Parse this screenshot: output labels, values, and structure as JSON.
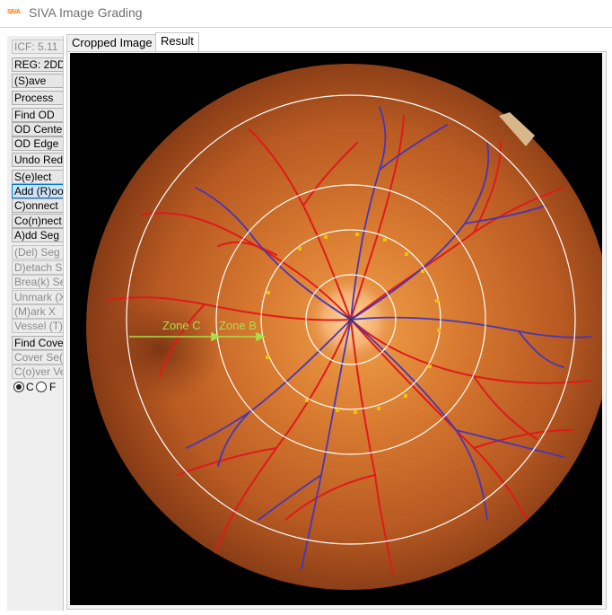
{
  "app": {
    "logo_text": "SIVA",
    "title": "SIVA Image Grading"
  },
  "sidebar": {
    "icf_label": "ICF: 5.11",
    "reg_label": "REG: 2DD",
    "save": "(S)ave",
    "process": "Process",
    "find_od": "Find OD",
    "od_center": "OD Center",
    "od_edge": "OD Edge",
    "undo_redo": "Undo Redo",
    "select": "S(e)lect",
    "add_root": "Add (R)oot",
    "connect": "C)onnect",
    "connect2": "Co(n)nect",
    "add_seg": "A)dd Seg",
    "del_seg": "(Del) Seg",
    "detach_s": "D)etach S",
    "break_seg": "Brea(k) Seg",
    "unmark": "Unmark (X)",
    "mark_x": "(M)ark X",
    "vessel_type": "Vessel (T)ype",
    "find_cover": "Find Cover",
    "cover_se": "Cover Se(q)",
    "cover_ve": "C(o)ver Ve",
    "radio_c": "C",
    "radio_f": "F"
  },
  "tabs": {
    "cropped_image": "Cropped Image",
    "result": "Result"
  },
  "overlay": {
    "zone_c": "Zone C",
    "zone_b": "Zone B"
  },
  "colors": {
    "artery": "#e01a1a",
    "vein": "#4636b8",
    "zone_label": "#a8e04a",
    "crossing_marker": "#f2c200",
    "ring": "#ffffff"
  }
}
